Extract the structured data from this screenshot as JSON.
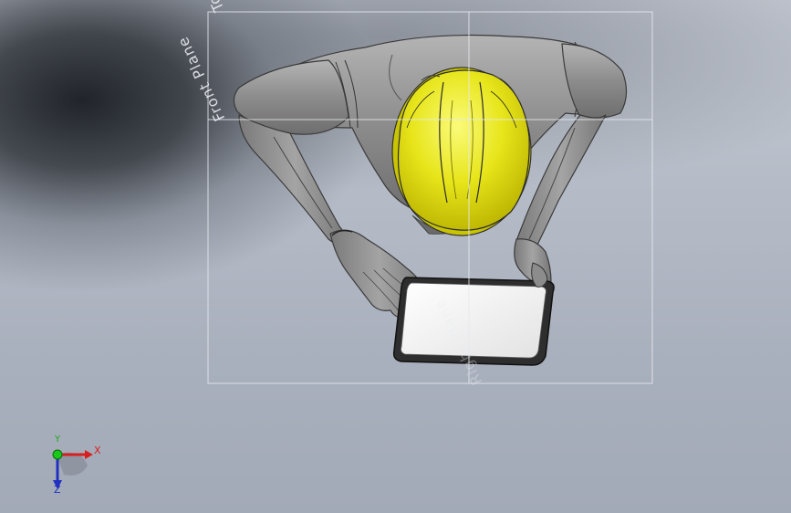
{
  "planes": {
    "top": "Top Plane",
    "front": "Front Plane",
    "right": "Right Plane"
  },
  "triad": {
    "x": "X",
    "y": "Y",
    "z": "Z"
  },
  "colors": {
    "helmet": "#e7e51a",
    "body": "#8e8e8e",
    "tablet_screen": "#f2f2f2",
    "axis_x": "#d62020",
    "axis_y": "#18a818",
    "axis_z": "#2030c0"
  }
}
